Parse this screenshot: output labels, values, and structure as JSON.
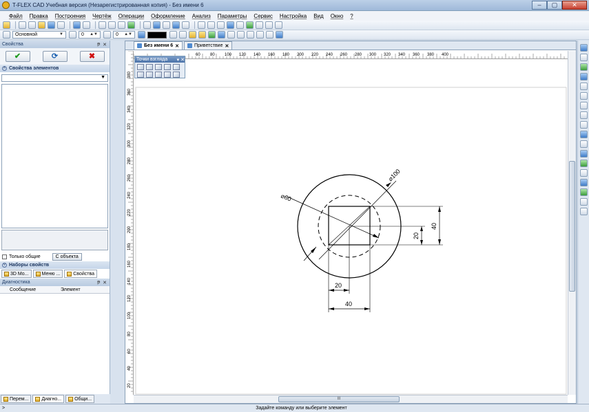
{
  "window": {
    "title": "T-FLEX CAD Учебная версия (Незарегистрированная копия) - Без имени 6"
  },
  "menu": [
    "Файл",
    "Правка",
    "Построения",
    "Чертёж",
    "Операции",
    "Оформление",
    "Анализ",
    "Параметры",
    "Сервис",
    "Настройка",
    "Вид",
    "Окно",
    "?"
  ],
  "toolbar2": {
    "layer": "Основной",
    "priority": "0",
    "level": "0"
  },
  "left_panel": {
    "header": "Свойства",
    "section_props": "Свойства элементов",
    "only_common_label": "Только общие",
    "from_object_btn": "С объекта",
    "section_sets": "Наборы свойств",
    "tabs": [
      "3D Мо...",
      "Меню ...",
      "Свойства"
    ],
    "diagnostics_header": "Диагностика",
    "diag_col_message": "Сообщение",
    "diag_col_element": "Элемент",
    "bottom_tabs": [
      "Перем...",
      "Диагно...",
      "Общи..."
    ]
  },
  "doc_tabs": [
    {
      "label": "Без имени 6",
      "active": true
    },
    {
      "label": "Приветствие",
      "active": false
    }
  ],
  "view_panel": {
    "title": "Точки взгляда"
  },
  "hruler_ticks": [
    "60",
    "80",
    "100",
    "120",
    "140",
    "160",
    "180",
    "200",
    "220",
    "240",
    "260",
    "280",
    "300",
    "320",
    "340",
    "360",
    "380",
    "400"
  ],
  "vruler_ticks": [
    "380",
    "360",
    "340",
    "320",
    "300",
    "280",
    "260",
    "240",
    "220",
    "200",
    "180",
    "160",
    "140",
    "120",
    "100",
    "80",
    "60",
    "40",
    "20"
  ],
  "drawing": {
    "dim_dia_outer": "⌀100",
    "dim_dia_inner": "⌀60",
    "dim_height_outer": "40",
    "dim_height_inner": "20",
    "dim_width_inner": "20",
    "dim_width_outer": "40"
  },
  "hscroll_label": "III",
  "status": {
    "prompt": ">",
    "message": "Задайте команду или выберите элемент"
  }
}
